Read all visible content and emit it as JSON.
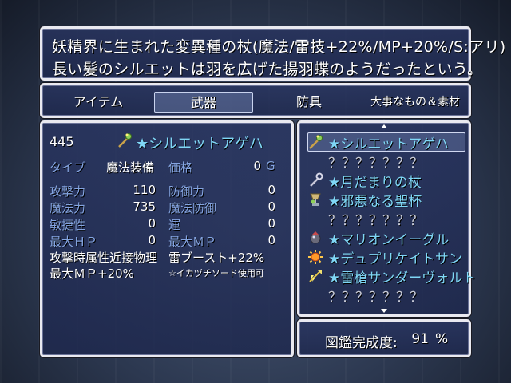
{
  "help": {
    "line1": "妖精界に生まれた変異種の杖(魔法/雷技+22%/MP+20%/S:アリ)",
    "line2": "長い髪のシルエットは羽を広げた揚羽蝶のようだったという。"
  },
  "categories": [
    {
      "label": "アイテム",
      "selected": false
    },
    {
      "label": "武器",
      "selected": true
    },
    {
      "label": "防具",
      "selected": false
    },
    {
      "label": "大事なもの＆素材",
      "selected": false
    }
  ],
  "detail": {
    "number": "445",
    "item_name": "★シルエットアゲハ",
    "item_icon": "staff-icon",
    "type_label": "タイプ",
    "type_value": "魔法装備",
    "price_label": "価格",
    "price_value": "0",
    "currency": "G",
    "stats_left": [
      {
        "label": "攻撃力",
        "value": "110"
      },
      {
        "label": "魔法力",
        "value": "735"
      },
      {
        "label": "敏捷性",
        "value": "0"
      },
      {
        "label": "最大ＨＰ",
        "value": "0"
      }
    ],
    "stats_right": [
      {
        "label": "防御力",
        "value": "0"
      },
      {
        "label": "魔法防御",
        "value": "0"
      },
      {
        "label": "運",
        "value": "0"
      },
      {
        "label": "最大ＭＰ",
        "value": "0"
      }
    ],
    "traits": [
      "攻撃時属性近接物理",
      "雷ブースト+22%",
      "最大ＭＰ+20%",
      "☆イカヅチソード使用可"
    ]
  },
  "weapon_list": [
    {
      "name": "★シルエットアゲハ",
      "icon": "staff-icon",
      "known": true,
      "selected": true
    },
    {
      "name": "？？？？？？？",
      "icon": "",
      "known": false,
      "selected": false
    },
    {
      "name": "★月だまりの杖",
      "icon": "key-wand-icon",
      "known": true,
      "selected": false
    },
    {
      "name": "★邪悪なる聖杯",
      "icon": "chalice-icon",
      "known": true,
      "selected": false
    },
    {
      "name": "？？？？？？？",
      "icon": "",
      "known": false,
      "selected": false
    },
    {
      "name": "★マリオンイーグル",
      "icon": "orb-icon",
      "known": true,
      "selected": false
    },
    {
      "name": "★デュプリケイトサン",
      "icon": "sun-icon",
      "known": true,
      "selected": false
    },
    {
      "name": "★雷槍サンダーヴォルト",
      "icon": "lightning-spear-icon",
      "known": true,
      "selected": false
    },
    {
      "name": "？？？？？？？",
      "icon": "",
      "known": false,
      "selected": false
    }
  ],
  "completion": {
    "label": "図鑑完成度:",
    "value": "91",
    "unit": "%"
  },
  "colors": {
    "system_text": "#84a4e0",
    "item_name": "#7fd6f5",
    "window_border": "#e9e9f0"
  }
}
